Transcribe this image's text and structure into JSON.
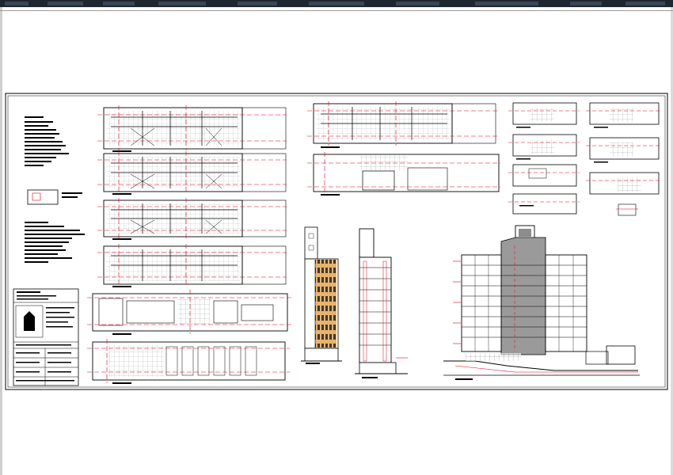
{
  "app": {
    "canvas_background": "#ffffff",
    "toolbar_color": "#1e2630",
    "line_colors": {
      "black": "#000000",
      "red": "#e0001a",
      "gray": "#8c8c8c",
      "facade": "#e9b36a"
    }
  },
  "drawing": {
    "sheet_type": "architectural-drawing-sheet",
    "views": [
      "floor-plans-left-column",
      "floor-plans-top-middle",
      "unit-detail-plans-right",
      "front-elevation",
      "side-section",
      "longitudinal-section",
      "title-block"
    ],
    "text_legible": false
  }
}
